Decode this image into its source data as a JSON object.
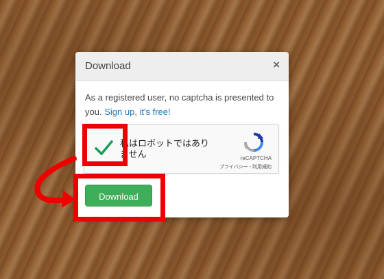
{
  "modal": {
    "title": "Download",
    "close_label": "×",
    "message": "As a registered user, no captcha is presented to you.",
    "signup_link": "Sign up, it's free!",
    "download_label": "Download"
  },
  "recaptcha": {
    "label": "私はロボットではありません",
    "brand": "reCAPTCHA",
    "links": "プライバシー - 利用規約",
    "checked": true
  },
  "colors": {
    "download_button": "#3fae5a",
    "link": "#1f77b4",
    "highlight": "#ee0000",
    "checkmark": "#1a9e57"
  }
}
